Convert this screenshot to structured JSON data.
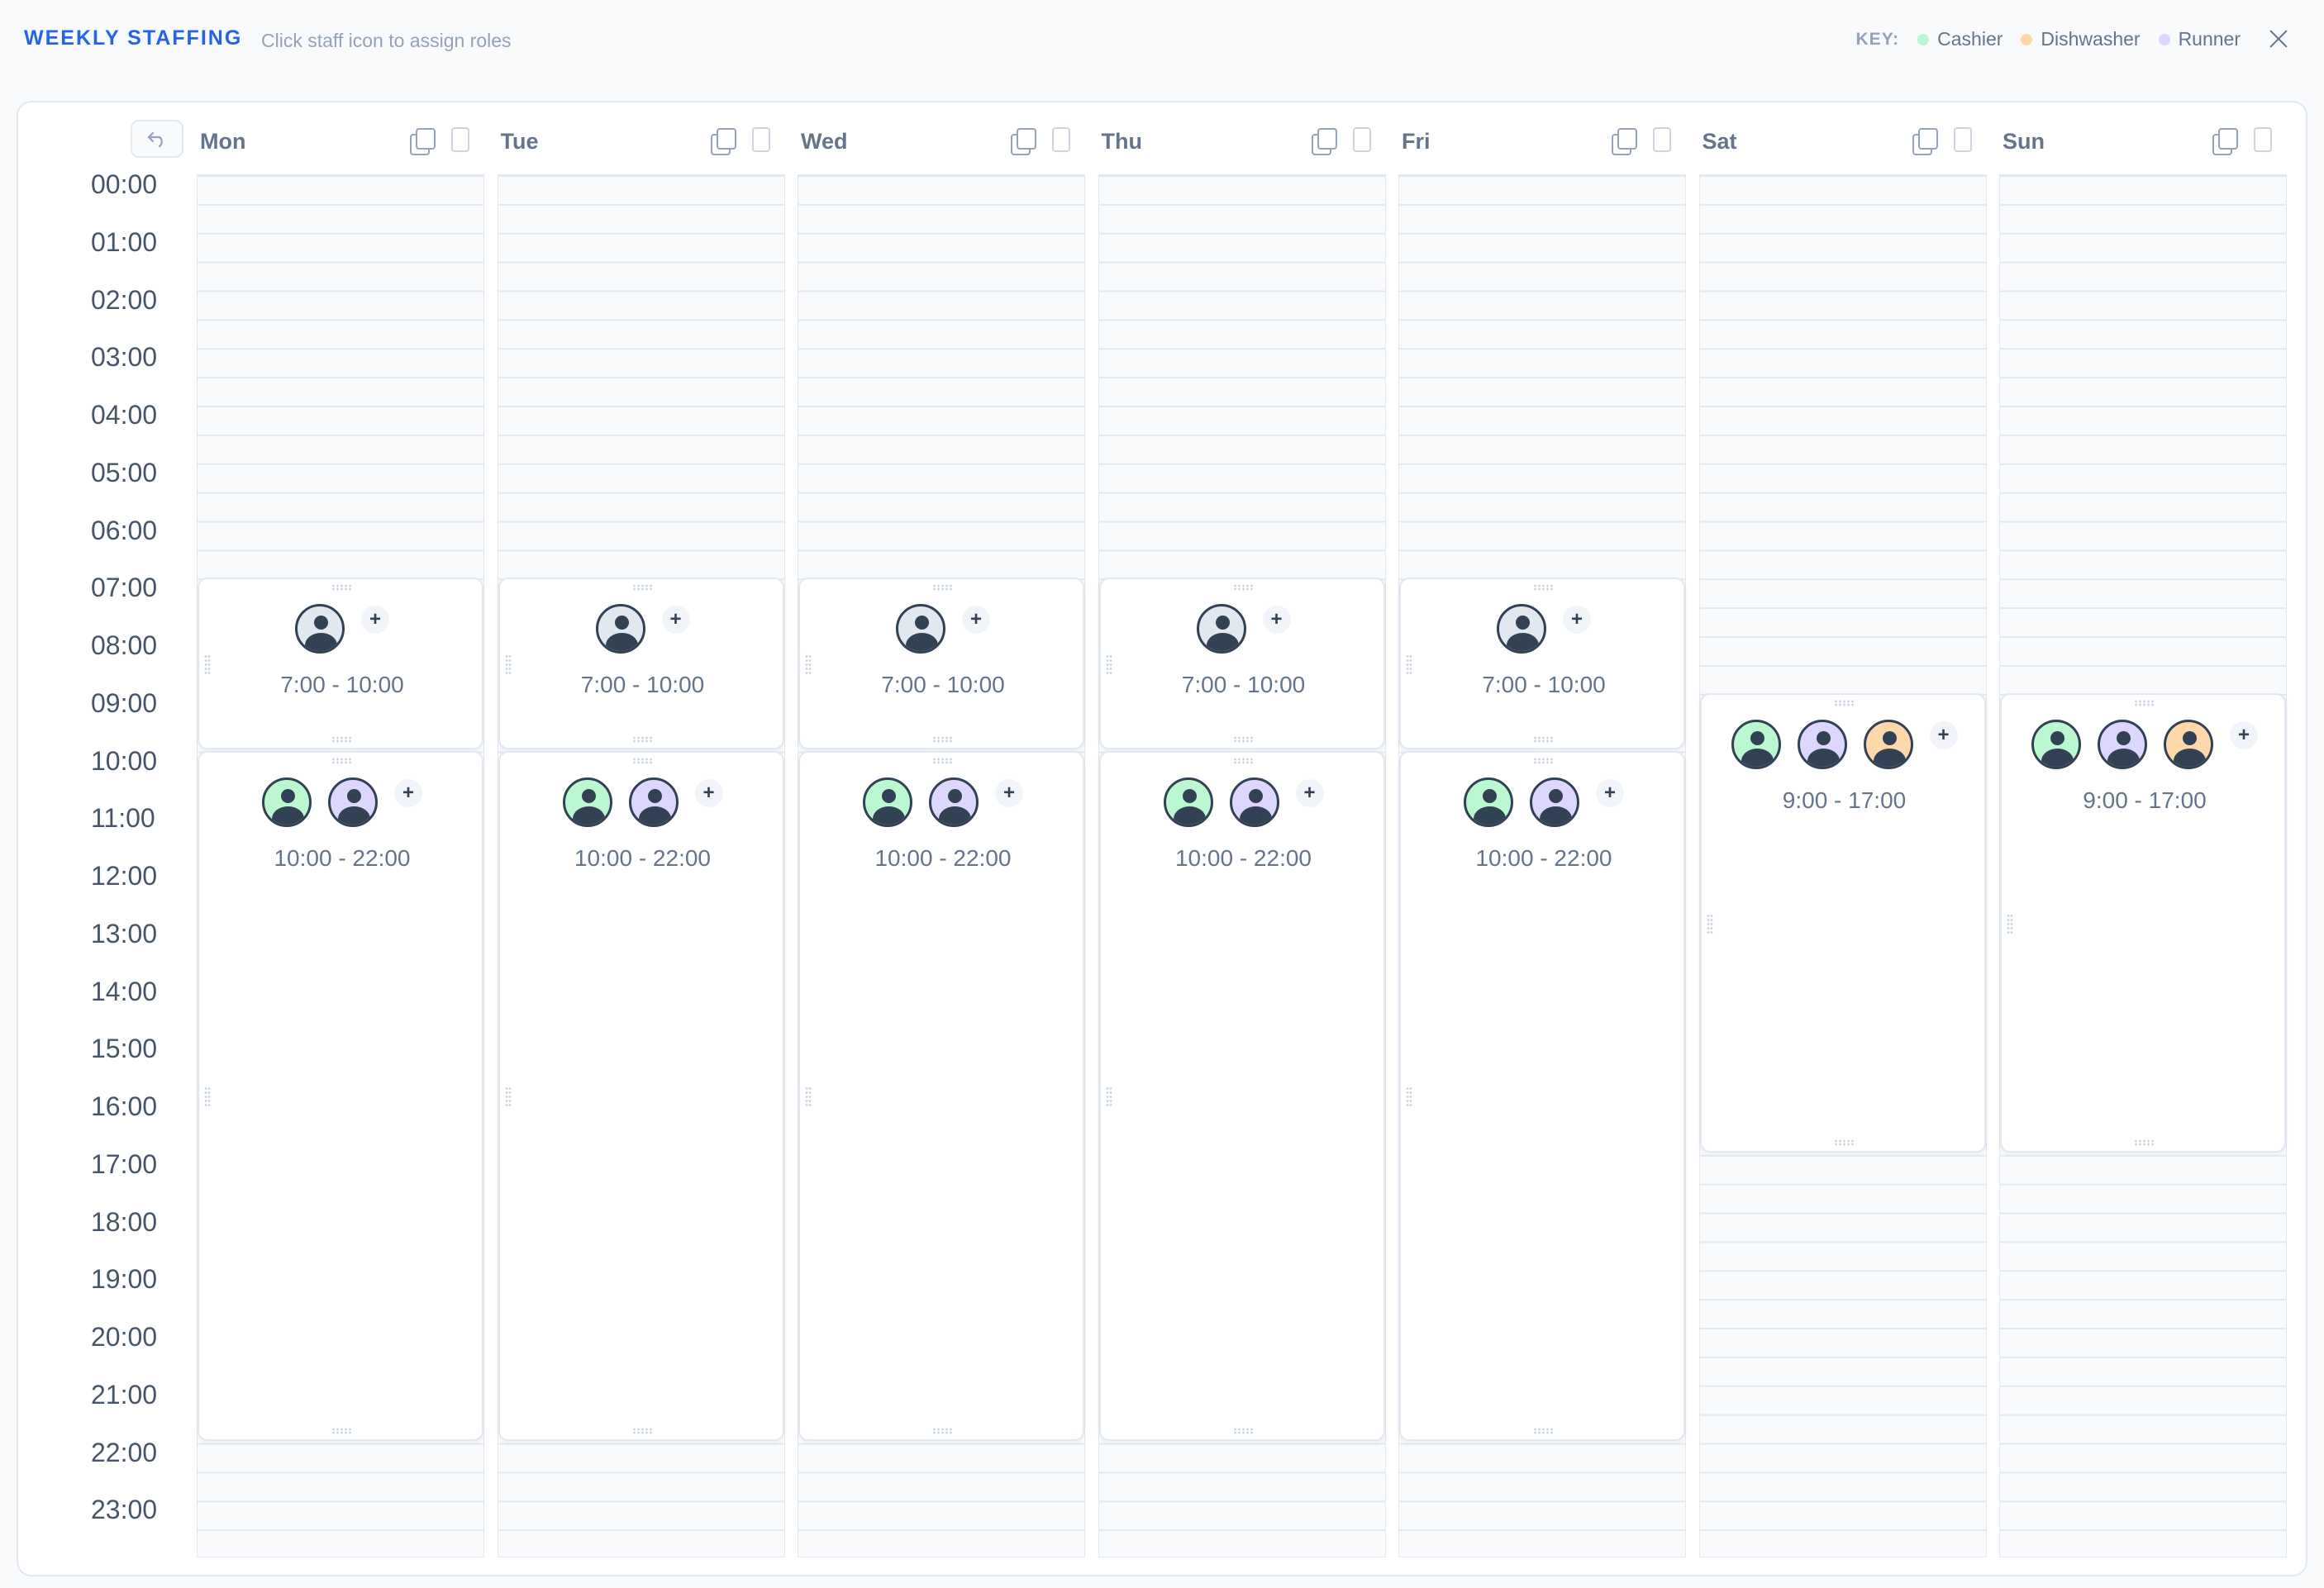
{
  "header": {
    "title": "WEEKLY STAFFING",
    "subtitle": "Click staff icon to assign roles",
    "key_label": "KEY:",
    "key": [
      {
        "label": "Cashier",
        "color": "#bbf7d0"
      },
      {
        "label": "Dishwasher",
        "color": "#fed7aa"
      },
      {
        "label": "Runner",
        "color": "#ddd6fe"
      }
    ],
    "close_icon": "close-icon"
  },
  "toolbar": {
    "undo_icon": "undo-icon"
  },
  "hours": [
    "00:00",
    "01:00",
    "02:00",
    "03:00",
    "04:00",
    "05:00",
    "06:00",
    "07:00",
    "08:00",
    "09:00",
    "10:00",
    "11:00",
    "12:00",
    "13:00",
    "14:00",
    "15:00",
    "16:00",
    "17:00",
    "18:00",
    "19:00",
    "20:00",
    "21:00",
    "22:00",
    "23:00"
  ],
  "days": [
    {
      "name": "Mon",
      "shifts": [
        {
          "label": "7:00 - 10:00",
          "start": 7,
          "end": 10,
          "staff": [
            "unassigned"
          ]
        },
        {
          "label": "10:00 - 22:00",
          "start": 10,
          "end": 22,
          "staff": [
            "cashier",
            "runner"
          ]
        }
      ]
    },
    {
      "name": "Tue",
      "shifts": [
        {
          "label": "7:00 - 10:00",
          "start": 7,
          "end": 10,
          "staff": [
            "unassigned"
          ]
        },
        {
          "label": "10:00 - 22:00",
          "start": 10,
          "end": 22,
          "staff": [
            "cashier",
            "runner"
          ]
        }
      ]
    },
    {
      "name": "Wed",
      "shifts": [
        {
          "label": "7:00 - 10:00",
          "start": 7,
          "end": 10,
          "staff": [
            "unassigned"
          ]
        },
        {
          "label": "10:00 - 22:00",
          "start": 10,
          "end": 22,
          "staff": [
            "cashier",
            "runner"
          ]
        }
      ]
    },
    {
      "name": "Thu",
      "shifts": [
        {
          "label": "7:00 - 10:00",
          "start": 7,
          "end": 10,
          "staff": [
            "unassigned"
          ]
        },
        {
          "label": "10:00 - 22:00",
          "start": 10,
          "end": 22,
          "staff": [
            "cashier",
            "runner"
          ]
        }
      ]
    },
    {
      "name": "Fri",
      "shifts": [
        {
          "label": "7:00 - 10:00",
          "start": 7,
          "end": 10,
          "staff": [
            "unassigned"
          ]
        },
        {
          "label": "10:00 - 22:00",
          "start": 10,
          "end": 22,
          "staff": [
            "cashier",
            "runner"
          ]
        }
      ]
    },
    {
      "name": "Sat",
      "shifts": [
        {
          "label": "9:00 - 17:00",
          "start": 9,
          "end": 17,
          "staff": [
            "cashier",
            "runner",
            "dishwasher"
          ]
        }
      ]
    },
    {
      "name": "Sun",
      "shifts": [
        {
          "label": "9:00 - 17:00",
          "start": 9,
          "end": 17,
          "staff": [
            "cashier",
            "runner",
            "dishwasher"
          ]
        }
      ]
    }
  ]
}
